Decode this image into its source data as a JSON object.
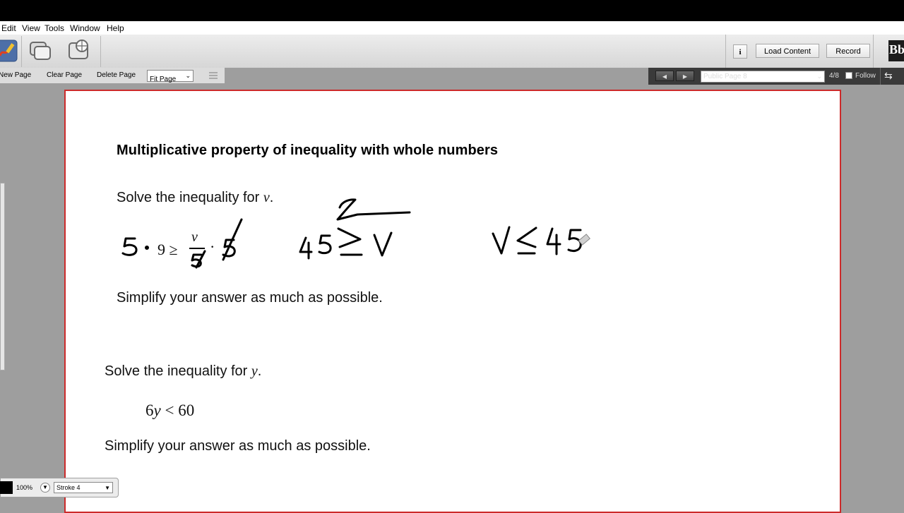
{
  "menu": {
    "edit": "Edit",
    "view": "View",
    "tools": "Tools",
    "window": "Window",
    "help": "Help"
  },
  "toolbar": {
    "load_content": "Load Content",
    "record": "Record",
    "info": "i",
    "logo_text": "Bb"
  },
  "page_tools": {
    "new_page": "New Page",
    "clear_page": "Clear Page",
    "delete_page": "Delete Page",
    "fit_option": "Fit Page"
  },
  "nav": {
    "page_select": "Public Page 8",
    "page_counter": "4/8",
    "follow": "Follow"
  },
  "content": {
    "heading": "Multiplicative property of inequality with whole numbers",
    "p1_prefix": "Solve the inequality for ",
    "p1_var": "v",
    "p1_suffix": ".",
    "ineq1_left": "9 ≥",
    "ineq1_num": "v",
    "ineq1_dot": "·",
    "p2": "Simplify your answer as much as possible.",
    "p3_prefix": "Solve the inequality for ",
    "p3_var": "y",
    "p3_suffix": ".",
    "ineq2_left": "6",
    "ineq2_var": "y",
    "ineq2_rest": " < 60",
    "p4": "Simplify your answer as much as possible."
  },
  "ink": {
    "hw1_left": "5",
    "hw2_left": "45",
    "hw2_right": "v",
    "hw3": "v ≤ 45"
  },
  "bottom": {
    "zoom": "100%",
    "stroke": "Stroke 4"
  },
  "colors": {
    "border_accent": "#cc2a2a",
    "ink": "#000000"
  }
}
